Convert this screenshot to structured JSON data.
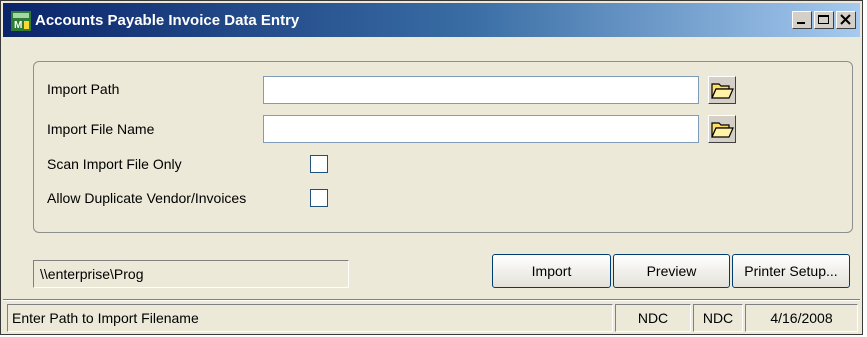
{
  "window": {
    "title": "Accounts Payable  Invoice Data Entry",
    "app_icon": "sage-mas90-icon",
    "controls": [
      "minimize-icon",
      "maximize-icon",
      "close-icon"
    ]
  },
  "form": {
    "import_path": {
      "label": "Import Path",
      "value": "",
      "browse_icon": "folder-open-icon"
    },
    "import_file_name": {
      "label": "Import File Name",
      "value": "",
      "browse_icon": "folder-open-icon"
    },
    "scan_import_file_only": {
      "label": "Scan Import File Only",
      "checked": false
    },
    "allow_duplicate": {
      "label": "Allow Duplicate Vendor/Invoices",
      "checked": false
    }
  },
  "path_display": "\\\\enterprise\\Prog",
  "buttons": {
    "import": "Import",
    "preview": "Preview",
    "printer_setup": "Printer Setup..."
  },
  "status_bar": {
    "message": "Enter Path to Import Filename",
    "company": "NDC",
    "user": "NDC",
    "date": "4/16/2008"
  },
  "colors": {
    "title_bar_start": "#0a246a",
    "title_bar_end": "#a6caf0",
    "window_bg": "#ece9d8",
    "folder_icon": "#ffe066"
  }
}
